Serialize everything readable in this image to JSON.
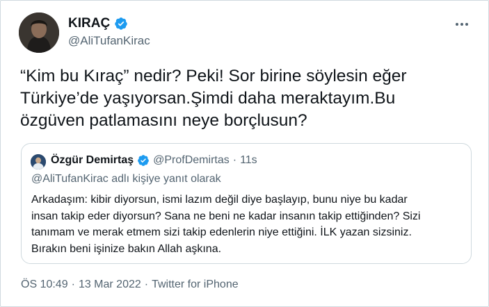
{
  "tweet": {
    "author_name": "KIRAÇ",
    "author_handle": "@AliTufanKirac",
    "verified": true,
    "text": "“Kim bu Kıraç” nedir? Peki! Sor birine söylesin eğer\nTürkiye’de yaşıyorsan.Şimdi daha meraktayım.Bu\nözgüven patlamasını neye borçlusun?",
    "more_icon": "more-horizontal-icon"
  },
  "quoted": {
    "author_name": "Özgür Demirtaş",
    "author_handle": "@ProfDemirtas",
    "separator": "·",
    "time": "11s",
    "verified": true,
    "reply_context": "@AliTufanKirac adlı kişiye yanıt olarak",
    "text": "Arkadaşım: kibir diyorsun, ismi lazım değil diye başlayıp, bunu niye bu kadar\ninsan takip eder diyorsun? Sana ne beni ne kadar insanın takip ettiğinden? Sizi\ntanımam ve merak etmem sizi takip edenlerin niye ettiğini. İLK yazan sizsiniz.\nBırakın beni işinize bakın Allah aşkına."
  },
  "meta": {
    "time": "ÖS 10:49",
    "separator1": "·",
    "date": "13 Mar 2022",
    "separator2": "·",
    "source": "Twitter for iPhone"
  },
  "colors": {
    "verified_blue": "#1d9bf0",
    "secondary_text": "#536471",
    "primary_text": "#0f1419",
    "border": "#cfd9de"
  }
}
